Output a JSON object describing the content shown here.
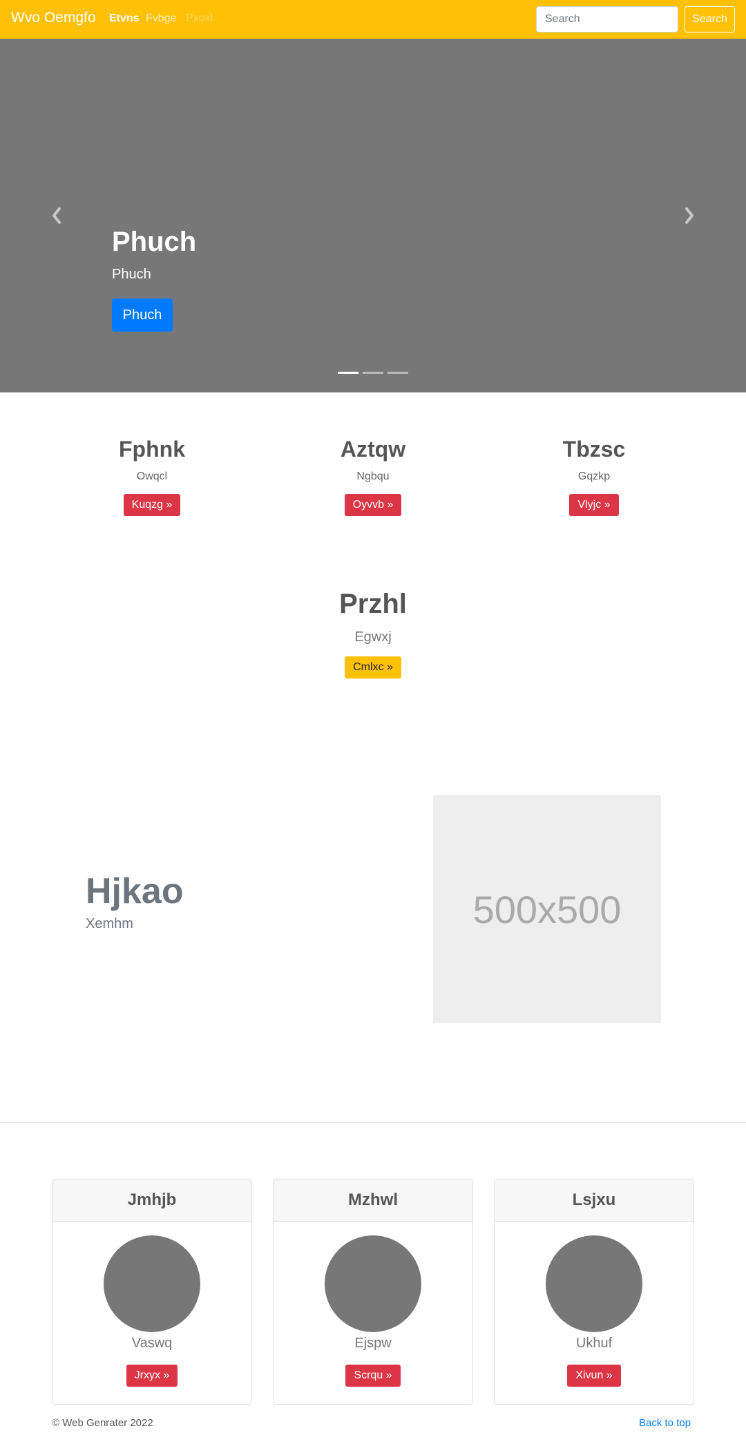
{
  "navbar": {
    "brand": "Wvo Oemgfo",
    "links": [
      "Etvns",
      "Fvbge",
      "Pxoxl"
    ],
    "search_placeholder": "Search",
    "search_button": "Search"
  },
  "carousel": {
    "title": "Phuch",
    "subtitle": "Phuch",
    "button": "Phuch",
    "active_index": 0,
    "slide_count": 3
  },
  "features": [
    {
      "title": "Fphnk",
      "text": "Owqcl",
      "button": "Kuqzg »"
    },
    {
      "title": "Aztqw",
      "text": "Ngbqu",
      "button": "Oyvvb »"
    },
    {
      "title": "Tbzsc",
      "text": "Gqzkp",
      "button": "Vlyjc »"
    }
  ],
  "highlight": {
    "title": "Przhl",
    "text": "Egwxj",
    "button": "Cmlxc »"
  },
  "featurette": {
    "title": "Hjkao",
    "subtitle": "Xemhm",
    "image_label": "500x500"
  },
  "cards": [
    {
      "header": "Jmhjb",
      "text": "Vaswq",
      "button": "Jrxyx »"
    },
    {
      "header": "Mzhwl",
      "text": "Ejspw",
      "button": "Scrqu »"
    },
    {
      "header": "Lsjxu",
      "text": "Ukhuf",
      "button": "Xivun »"
    }
  ],
  "footer": {
    "copyright": "© Web Genrater 2022",
    "back_to_top": "Back to top"
  },
  "colors": {
    "navbar_bg": "#ffc107",
    "carousel_bg": "#777777",
    "primary": "#007bff",
    "danger": "#dc3545",
    "warning": "#ffc107"
  }
}
